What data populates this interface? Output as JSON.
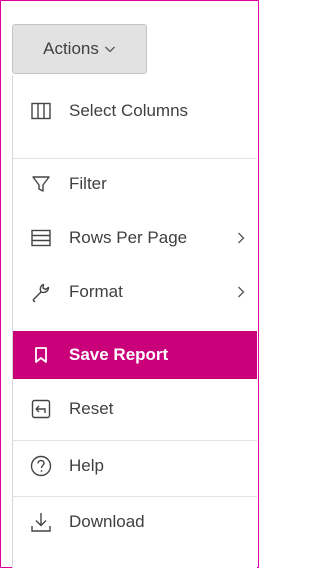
{
  "actions_button": {
    "label": "Actions"
  },
  "menu": {
    "items": [
      {
        "label": "Select Columns",
        "icon": "columns-icon",
        "submenu": false
      },
      {
        "label": "Filter",
        "icon": "filter-icon",
        "submenu": false
      },
      {
        "label": "Rows Per Page",
        "icon": "rows-icon",
        "submenu": true
      },
      {
        "label": "Format",
        "icon": "wrench-icon",
        "submenu": true
      },
      {
        "label": "Save Report",
        "icon": "bookmark-icon",
        "submenu": false,
        "selected": true
      },
      {
        "label": "Reset",
        "icon": "reset-icon",
        "submenu": false
      },
      {
        "label": "Help",
        "icon": "help-icon",
        "submenu": false
      },
      {
        "label": "Download",
        "icon": "download-icon",
        "submenu": false
      }
    ]
  },
  "colors": {
    "accent": "#c9007a",
    "frame": "#e0009e",
    "button_bg": "#e2e2e2"
  }
}
